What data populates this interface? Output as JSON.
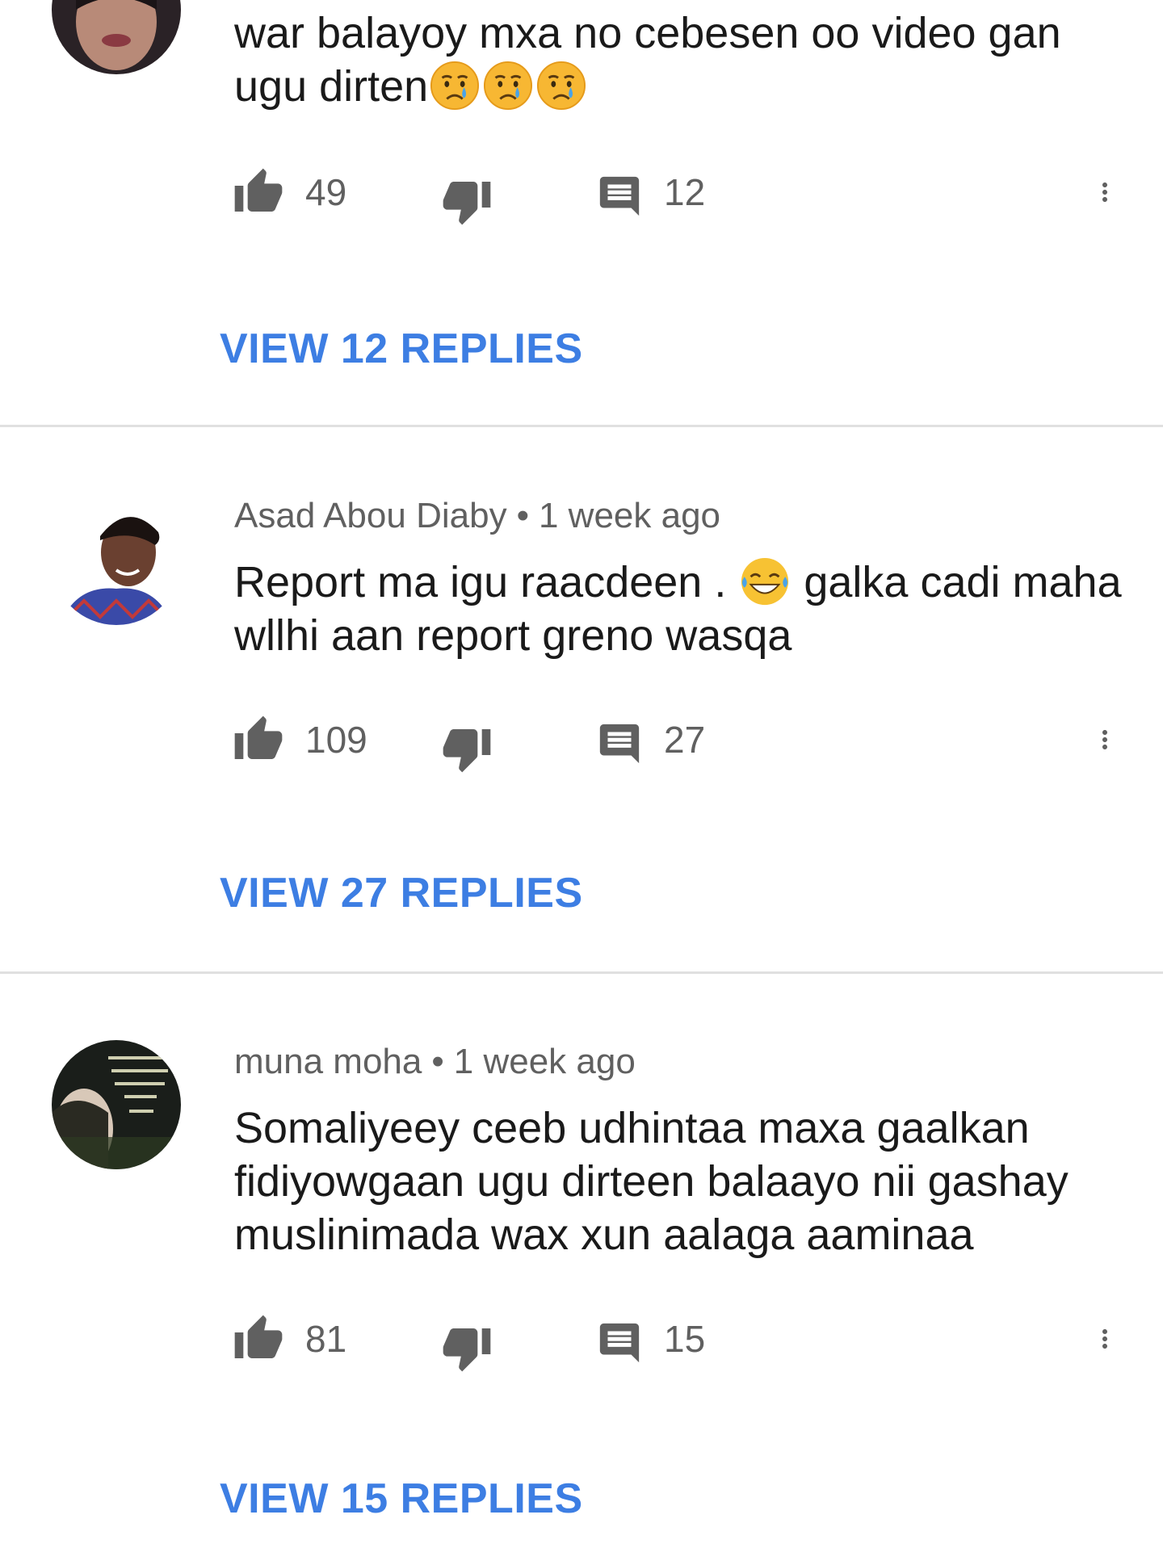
{
  "colors": {
    "link_blue": "#3d7ee3",
    "meta_gray": "#606060",
    "icon_gray": "#606060",
    "divider": "#e0e0e0"
  },
  "comments": [
    {
      "author": "",
      "time": "",
      "text_before_emoji": "war balayoy mxa no cebesen oo video gan ugu dirten",
      "emoji": [
        "crying-face",
        "crying-face",
        "crying-face"
      ],
      "text_after_emoji": "",
      "likes": "49",
      "replies_count": "12",
      "view_replies_label": "VIEW 12 REPLIES"
    },
    {
      "author": "Asad Abou Diaby",
      "time": "1 week ago",
      "text_before_emoji": "Report ma igu raacdeen . ",
      "emoji": [
        "tears-of-joy-face"
      ],
      "text_after_emoji": " galka cadi maha wllhi aan report greno wasqa",
      "likes": "109",
      "replies_count": "27",
      "view_replies_label": "VIEW 27 REPLIES"
    },
    {
      "author": "muna moha",
      "time": "1 week ago",
      "text_before_emoji": "Somaliyeey ceeb udhintaa maxa gaalkan fidiyowgaan ugu dirteen balaayo nii gashay muslinimada wax xun aalaga aaminaa",
      "emoji": [],
      "text_after_emoji": "",
      "likes": "81",
      "replies_count": "15",
      "view_replies_label": "VIEW 15 REPLIES"
    }
  ],
  "separator": "•",
  "icons": {
    "like": "thumbs-up-icon",
    "dislike": "thumbs-down-icon",
    "reply": "comment-icon",
    "more": "more-vert-icon"
  }
}
